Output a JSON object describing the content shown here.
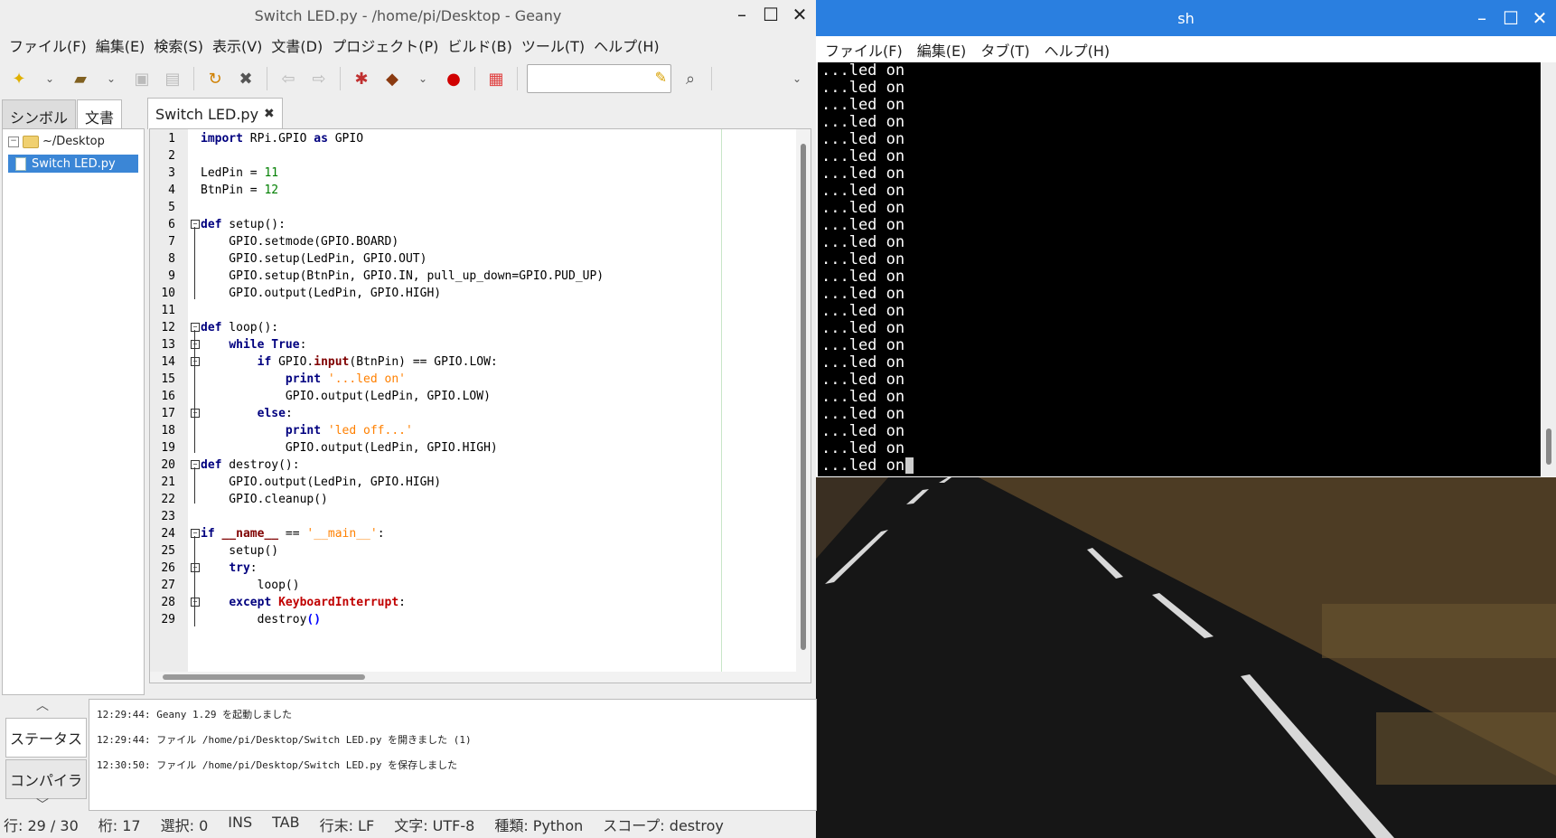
{
  "geany": {
    "title": "Switch LED.py - /home/pi/Desktop - Geany",
    "menu": [
      "ファイル(F)",
      "編集(E)",
      "検索(S)",
      "表示(V)",
      "文書(D)",
      "プロジェクト(P)",
      "ビルド(B)",
      "ツール(T)",
      "ヘルプ(H)"
    ],
    "sidebar_tabs": [
      "シンボル",
      "文書"
    ],
    "tree_root": "~/Desktop",
    "tree_file": "Switch LED.py",
    "editor_tab": "Switch LED.py",
    "message_tabs": [
      "ステータス",
      "コンパイラ"
    ],
    "messages": [
      "12:29:44: Geany 1.29 を起動しました",
      "12:29:44: ファイル /home/pi/Desktop/Switch LED.py を開きました (1)",
      "12:30:50: ファイル /home/pi/Desktop/Switch LED.py を保存しました"
    ],
    "status": [
      "行: 29 / 30",
      "桁: 17",
      "選択: 0",
      "INS",
      "TAB",
      "行末: LF",
      "文字: UTF-8",
      "種類: Python",
      "スコープ: destroy"
    ]
  },
  "code_lines": [
    "1",
    "2",
    "3",
    "4",
    "5",
    "6",
    "7",
    "8",
    "9",
    "10",
    "11",
    "12",
    "13",
    "14",
    "15",
    "16",
    "17",
    "18",
    "19",
    "20",
    "21",
    "22",
    "23",
    "24",
    "25",
    "26",
    "27",
    "28",
    "29"
  ],
  "terminal": {
    "title": "sh",
    "menu": [
      "ファイル(F)",
      "編集(E)",
      "タブ(T)",
      "ヘルプ(H)"
    ],
    "line_text": "...led on",
    "line_count": 24
  },
  "icons": [
    "new-file-icon",
    "open-file-icon",
    "save-icon",
    "save-all-icon",
    "revert-icon",
    "close-icon",
    "back-icon",
    "forward-icon",
    "compile-icon",
    "build-icon",
    "run-icon",
    "color-chooser-icon",
    "search-icon",
    "broom-icon"
  ]
}
